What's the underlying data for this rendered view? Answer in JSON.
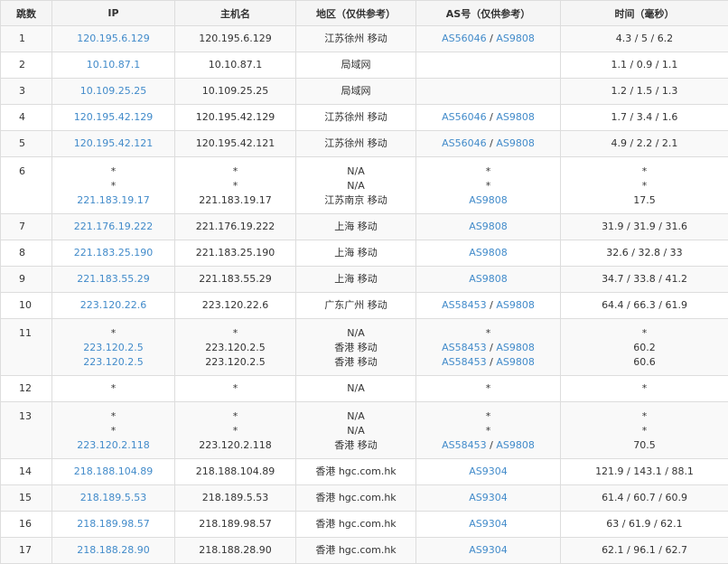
{
  "colors": {
    "link": "#428bca",
    "text": "#333333",
    "border": "#dddddd",
    "header_bg": "#f5f5f5",
    "stripe": "#f9f9f9"
  },
  "headers": {
    "hop": "跳数",
    "ip": "IP",
    "hostname": "主机名",
    "region": "地区（仅供参考）",
    "as": "AS号（仅供参考）",
    "time": "时间（毫秒）"
  },
  "rows": [
    {
      "hop": "1",
      "entries": [
        {
          "ip": "120.195.6.129",
          "host": "120.195.6.129",
          "region": "江苏徐州 移动",
          "as": [
            "AS56046",
            "AS9808"
          ],
          "time": "4.3 / 5 / 6.2"
        }
      ]
    },
    {
      "hop": "2",
      "entries": [
        {
          "ip": "10.10.87.1",
          "host": "10.10.87.1",
          "region": "局域网",
          "as": [],
          "time": "1.1 / 0.9 / 1.1"
        }
      ]
    },
    {
      "hop": "3",
      "entries": [
        {
          "ip": "10.109.25.25",
          "host": "10.109.25.25",
          "region": "局域网",
          "as": [],
          "time": "1.2 / 1.5 / 1.3"
        }
      ]
    },
    {
      "hop": "4",
      "entries": [
        {
          "ip": "120.195.42.129",
          "host": "120.195.42.129",
          "region": "江苏徐州 移动",
          "as": [
            "AS56046",
            "AS9808"
          ],
          "time": "1.7 / 3.4 / 1.6"
        }
      ]
    },
    {
      "hop": "5",
      "entries": [
        {
          "ip": "120.195.42.121",
          "host": "120.195.42.121",
          "region": "江苏徐州 移动",
          "as": [
            "AS56046",
            "AS9808"
          ],
          "time": "4.9 / 2.2 / 2.1"
        }
      ]
    },
    {
      "hop": "6",
      "entries": [
        {
          "ip": "*",
          "host": "*",
          "region": "N/A",
          "as": [
            "*"
          ],
          "time": "*"
        },
        {
          "ip": "*",
          "host": "*",
          "region": "N/A",
          "as": [
            "*"
          ],
          "time": "*"
        },
        {
          "ip": "221.183.19.17",
          "host": "221.183.19.17",
          "region": "江苏南京 移动",
          "as": [
            "AS9808"
          ],
          "time": "17.5"
        }
      ]
    },
    {
      "hop": "7",
      "entries": [
        {
          "ip": "221.176.19.222",
          "host": "221.176.19.222",
          "region": "上海 移动",
          "as": [
            "AS9808"
          ],
          "time": "31.9 / 31.9 / 31.6"
        }
      ]
    },
    {
      "hop": "8",
      "entries": [
        {
          "ip": "221.183.25.190",
          "host": "221.183.25.190",
          "region": "上海 移动",
          "as": [
            "AS9808"
          ],
          "time": "32.6 / 32.8 / 33"
        }
      ]
    },
    {
      "hop": "9",
      "entries": [
        {
          "ip": "221.183.55.29",
          "host": "221.183.55.29",
          "region": "上海 移动",
          "as": [
            "AS9808"
          ],
          "time": "34.7 / 33.8 / 41.2"
        }
      ]
    },
    {
      "hop": "10",
      "entries": [
        {
          "ip": "223.120.22.6",
          "host": "223.120.22.6",
          "region": "广东广州 移动",
          "as": [
            "AS58453",
            "AS9808"
          ],
          "time": "64.4 / 66.3 / 61.9"
        }
      ]
    },
    {
      "hop": "11",
      "entries": [
        {
          "ip": "*",
          "host": "*",
          "region": "N/A",
          "as": [
            "*"
          ],
          "time": "*"
        },
        {
          "ip": "223.120.2.5",
          "host": "223.120.2.5",
          "region": "香港 移动",
          "as": [
            "AS58453",
            "AS9808"
          ],
          "time": "60.2"
        },
        {
          "ip": "223.120.2.5",
          "host": "223.120.2.5",
          "region": "香港 移动",
          "as": [
            "AS58453",
            "AS9808"
          ],
          "time": "60.6"
        }
      ]
    },
    {
      "hop": "12",
      "entries": [
        {
          "ip": "*",
          "host": "*",
          "region": "N/A",
          "as": [
            "*"
          ],
          "time": "*"
        }
      ]
    },
    {
      "hop": "13",
      "entries": [
        {
          "ip": "*",
          "host": "*",
          "region": "N/A",
          "as": [
            "*"
          ],
          "time": "*"
        },
        {
          "ip": "*",
          "host": "*",
          "region": "N/A",
          "as": [
            "*"
          ],
          "time": "*"
        },
        {
          "ip": "223.120.2.118",
          "host": "223.120.2.118",
          "region": "香港 移动",
          "as": [
            "AS58453",
            "AS9808"
          ],
          "time": "70.5"
        }
      ]
    },
    {
      "hop": "14",
      "entries": [
        {
          "ip": "218.188.104.89",
          "host": "218.188.104.89",
          "region": "香港 hgc.com.hk",
          "as": [
            "AS9304"
          ],
          "time": "121.9 / 143.1 / 88.1"
        }
      ]
    },
    {
      "hop": "15",
      "entries": [
        {
          "ip": "218.189.5.53",
          "host": "218.189.5.53",
          "region": "香港 hgc.com.hk",
          "as": [
            "AS9304"
          ],
          "time": "61.4 / 60.7 / 60.9"
        }
      ]
    },
    {
      "hop": "16",
      "entries": [
        {
          "ip": "218.189.98.57",
          "host": "218.189.98.57",
          "region": "香港 hgc.com.hk",
          "as": [
            "AS9304"
          ],
          "time": "63 / 61.9 / 62.1"
        }
      ]
    },
    {
      "hop": "17",
      "entries": [
        {
          "ip": "218.188.28.90",
          "host": "218.188.28.90",
          "region": "香港 hgc.com.hk",
          "as": [
            "AS9304"
          ],
          "time": "62.1 / 96.1 / 62.7"
        }
      ]
    }
  ]
}
